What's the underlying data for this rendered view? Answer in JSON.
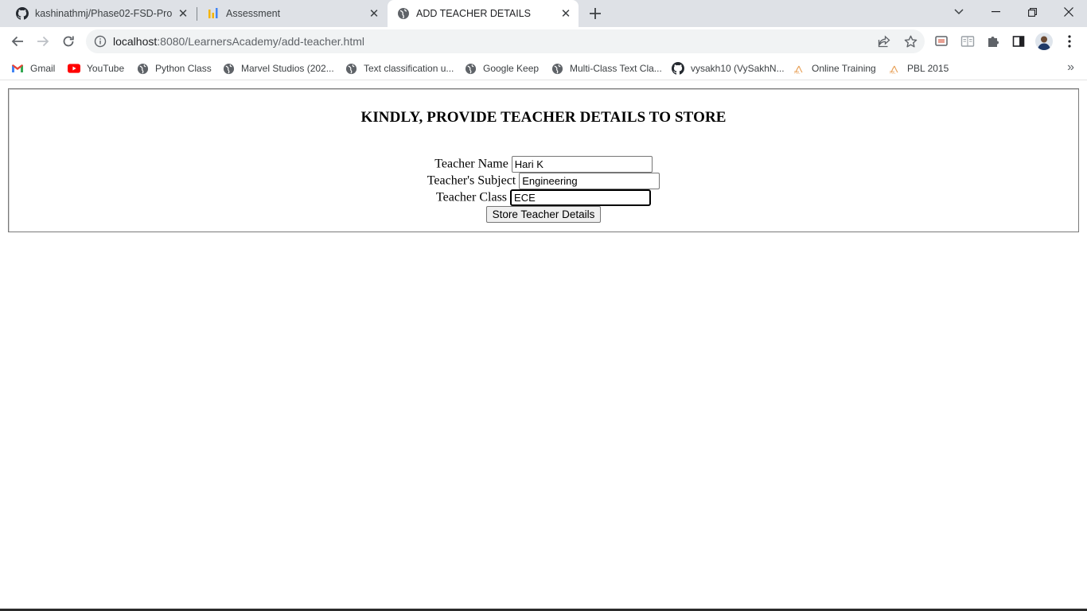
{
  "browser": {
    "tabs": [
      {
        "title": "kashinathmj/Phase02-FSD-Project",
        "icon": "github-icon",
        "active": false
      },
      {
        "title": "Assessment",
        "icon": "bar-chart-icon",
        "active": false
      },
      {
        "title": "ADD TEACHER DETAILS",
        "icon": "globe-icon",
        "active": true
      }
    ],
    "address": {
      "host": "localhost",
      "path": ":8080/LearnersAcademy/add-teacher.html"
    },
    "bookmarks": [
      {
        "label": "Gmail",
        "icon": "gmail-icon"
      },
      {
        "label": "YouTube",
        "icon": "youtube-icon"
      },
      {
        "label": "Python Class",
        "icon": "globe-icon"
      },
      {
        "label": "Marvel Studios (202...",
        "icon": "globe-icon"
      },
      {
        "label": "Text classification u...",
        "icon": "globe-icon"
      },
      {
        "label": "Google Keep",
        "icon": "globe-icon"
      },
      {
        "label": "Multi-Class Text Cla...",
        "icon": "globe-icon"
      },
      {
        "label": "vysakh10 (VySakhN...",
        "icon": "github-icon"
      },
      {
        "label": "Online Training",
        "icon": "pbl-icon"
      },
      {
        "label": "PBL 2015",
        "icon": "pbl-icon"
      }
    ],
    "more_bookmarks": "»"
  },
  "page": {
    "heading": "KINDLY, PROVIDE TEACHER DETAILS TO STORE",
    "fields": {
      "name": {
        "label": "Teacher Name",
        "value": "Hari K"
      },
      "subject": {
        "label": "Teacher's Subject",
        "value": "Engineering"
      },
      "class": {
        "label": "Teacher Class",
        "value": "ECE"
      }
    },
    "submit_label": "Store Teacher Details"
  }
}
